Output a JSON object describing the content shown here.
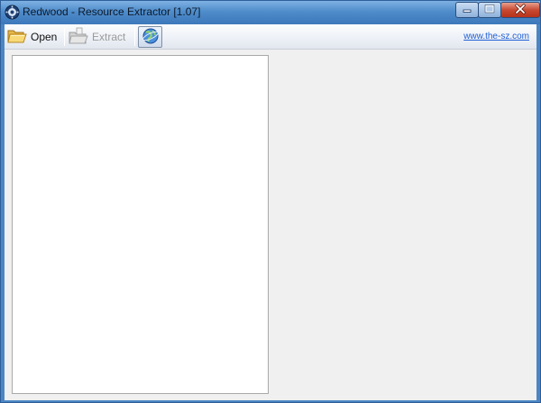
{
  "window": {
    "title": "Redwood - Resource Extractor [1.07]",
    "icon": "gear-icon",
    "controls": {
      "minimize_icon": "minimize-icon",
      "maximize_icon": "maximize-icon",
      "close_icon": "close-icon"
    }
  },
  "toolbar": {
    "open_label": "Open",
    "open_icon": "folder-open-icon",
    "extract_label": "Extract",
    "extract_icon": "extract-folder-icon",
    "web_icon": "globe-icon",
    "link_text": "www.the-sz.com"
  },
  "colors": {
    "titlebar": "#4f8cca",
    "link": "#1f5fd6",
    "disabled_text": "#9a9a9a",
    "panel_bg": "#ffffff",
    "client_bg": "#f0f0f0"
  }
}
